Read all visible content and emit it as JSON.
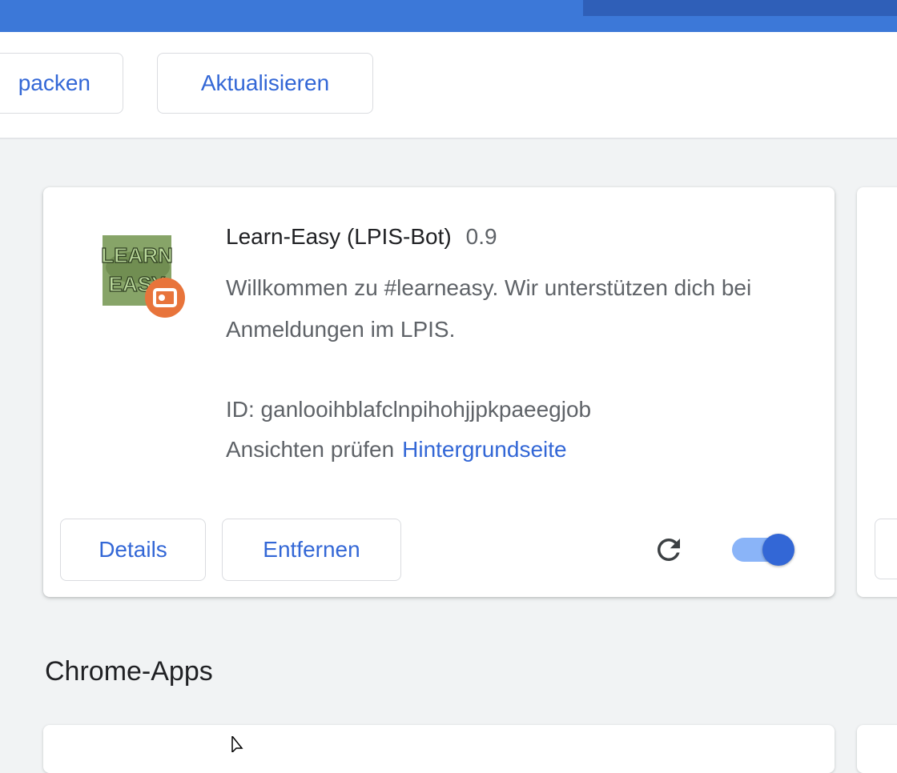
{
  "toolbar": {
    "pack_label": "packen",
    "update_label": "Aktualisieren"
  },
  "extension": {
    "name": "Learn-Easy (LPIS-Bot)",
    "version": "0.9",
    "description": "Willkommen zu #learneasy. Wir unterstützen dich bei Anmeldungen im LPIS.",
    "id_text": "ID: ganlooihblafclnpihohjjpkpaeegjob",
    "views_label": "Ansichten prüfen",
    "views_link": "Hintergrundseite",
    "icon_text_line1": "LEARN",
    "icon_text_line2": "EASY",
    "details_label": "Details",
    "remove_label": "Entfernen",
    "enabled": true
  },
  "section": {
    "title": "Chrome-Apps"
  },
  "colors": {
    "accent": "#3367d6",
    "topbar": "#3c78d8",
    "badge": "#e8743b"
  }
}
